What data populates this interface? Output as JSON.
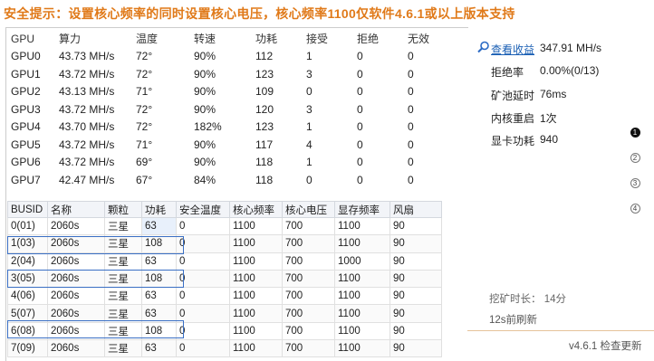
{
  "warning": "安全提示：设置核心频率的同时设置核心电压，核心频率1100仅软件4.6.1或以上版本支持",
  "gpu_table": {
    "headers": [
      "GPU",
      "算力",
      "温度",
      "转速",
      "功耗",
      "接受",
      "拒绝",
      "无效"
    ],
    "rows": [
      [
        "GPU0",
        "43.73 MH/s",
        "72°",
        "90%",
        "112",
        "1",
        "0",
        "0"
      ],
      [
        "GPU1",
        "43.72 MH/s",
        "72°",
        "90%",
        "123",
        "3",
        "0",
        "0"
      ],
      [
        "GPU2",
        "43.13 MH/s",
        "71°",
        "90%",
        "109",
        "0",
        "0",
        "0"
      ],
      [
        "GPU3",
        "43.72 MH/s",
        "72°",
        "90%",
        "120",
        "3",
        "0",
        "0"
      ],
      [
        "GPU4",
        "43.70 MH/s",
        "72°",
        "182%",
        "123",
        "1",
        "0",
        "0"
      ],
      [
        "GPU5",
        "43.72 MH/s",
        "71°",
        "90%",
        "117",
        "4",
        "0",
        "0"
      ],
      [
        "GPU6",
        "43.72 MH/s",
        "69°",
        "90%",
        "118",
        "1",
        "0",
        "0"
      ],
      [
        "GPU7",
        "42.47 MH/s",
        "67°",
        "84%",
        "118",
        "0",
        "0",
        "0"
      ]
    ]
  },
  "oc_grid": {
    "headers": [
      "BUSID",
      "名称",
      "颗粒",
      "功耗",
      "安全温度",
      "核心频率",
      "核心电压",
      "显存频率",
      "风扇"
    ],
    "rows": [
      [
        "0(01)",
        "2060s",
        "三星",
        "63",
        "0",
        "1100",
        "700",
        "1100",
        "90"
      ],
      [
        "1(03)",
        "2060s",
        "三星",
        "108",
        "0",
        "1100",
        "700",
        "1100",
        "90"
      ],
      [
        "2(04)",
        "2060s",
        "三星",
        "63",
        "0",
        "1100",
        "700",
        "1000",
        "90"
      ],
      [
        "3(05)",
        "2060s",
        "三星",
        "108",
        "0",
        "1100",
        "700",
        "1100",
        "90"
      ],
      [
        "4(06)",
        "2060s",
        "三星",
        "63",
        "0",
        "1100",
        "700",
        "1100",
        "90"
      ],
      [
        "5(07)",
        "2060s",
        "三星",
        "63",
        "0",
        "1100",
        "700",
        "1100",
        "90"
      ],
      [
        "6(08)",
        "2060s",
        "三星",
        "108",
        "0",
        "1100",
        "700",
        "1100",
        "90"
      ],
      [
        "7(09)",
        "2060s",
        "三星",
        "63",
        "0",
        "1100",
        "700",
        "1100",
        "90"
      ]
    ]
  },
  "stats": {
    "view_earnings": "查看收益",
    "hashrate": "347.91 MH/s",
    "reject_label": "拒绝率",
    "reject_value": "0.00%(0/13)",
    "latency_label": "矿池延时",
    "latency_value": "76ms",
    "restart_label": "内核重启",
    "restart_value": "1次",
    "power_label": "显卡功耗",
    "power_value": "940"
  },
  "pager": [
    "1",
    "2",
    "3",
    "4"
  ],
  "runtime": "挖矿时长：  14分",
  "refresh": "12s前刷新",
  "version": "v4.6.1  检查更新",
  "colors": {
    "warning": "#e07a1a",
    "link": "#1a5fb4",
    "selection": "#3a6fc4"
  }
}
